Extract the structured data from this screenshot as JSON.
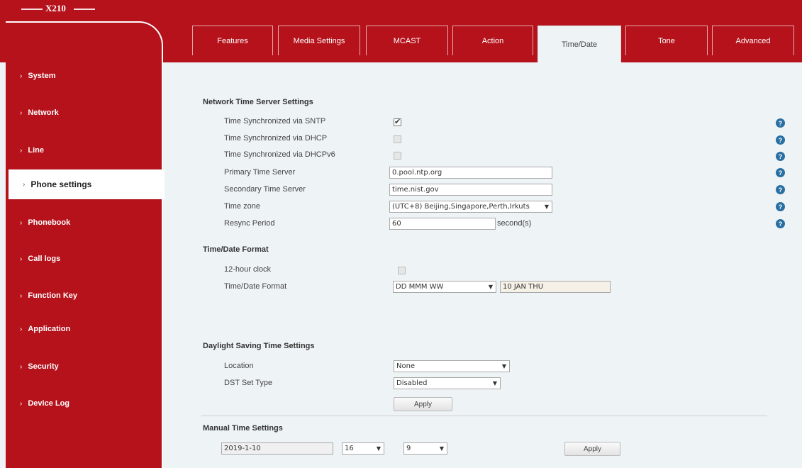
{
  "brand": {
    "model": "X210"
  },
  "tabs": [
    {
      "label": "Features",
      "active": false
    },
    {
      "label": "Media Settings",
      "active": false
    },
    {
      "label": "MCAST",
      "active": false
    },
    {
      "label": "Action",
      "active": false
    },
    {
      "label": "Time/Date",
      "active": true
    },
    {
      "label": "Tone",
      "active": false
    },
    {
      "label": "Advanced",
      "active": false
    }
  ],
  "sidebar": {
    "chevron": "›",
    "items": [
      {
        "label": "System"
      },
      {
        "label": "Network"
      },
      {
        "label": "Line"
      },
      {
        "label": "Phone settings",
        "active": true
      },
      {
        "label": "Phonebook"
      },
      {
        "label": "Call logs"
      },
      {
        "label": "Function Key"
      },
      {
        "label": "Application"
      },
      {
        "label": "Security"
      },
      {
        "label": "Device Log"
      }
    ]
  },
  "network_time": {
    "title": "Network Time Server Settings",
    "sntp_label": "Time Synchronized via SNTP",
    "sntp_checked": true,
    "dhcp_label": "Time Synchronized via DHCP",
    "dhcp_checked": false,
    "dhcpv6_label": "Time Synchronized via DHCPv6",
    "dhcpv6_checked": false,
    "primary_label": "Primary Time Server",
    "primary_value": "0.pool.ntp.org",
    "secondary_label": "Secondary Time Server",
    "secondary_value": "time.nist.gov",
    "timezone_label": "Time zone",
    "timezone_value": "(UTC+8) Beijing,Singapore,Perth,Irkuts",
    "resync_label": "Resync Period",
    "resync_value": "60",
    "resync_unit": "second(s)"
  },
  "format": {
    "title": "Time/Date Format",
    "clock12_label": "12-hour clock",
    "clock12_checked": false,
    "format_label": "Time/Date Format",
    "format_value": "DD MMM WW",
    "format_preview": "10 JAN THU"
  },
  "dst": {
    "title": "Daylight Saving Time Settings",
    "location_label": "Location",
    "location_value": "None",
    "type_label": "DST Set Type",
    "type_value": "Disabled",
    "apply_label": "Apply"
  },
  "manual": {
    "title": "Manual Time Settings",
    "date_value": "2019-1-10",
    "hour_value": "16",
    "minute_value": "9",
    "apply_label": "Apply"
  },
  "icons": {
    "help": "?",
    "dropdown": "▼",
    "help_color": "#2a6fa1",
    "brand_red": "#b5121b"
  }
}
